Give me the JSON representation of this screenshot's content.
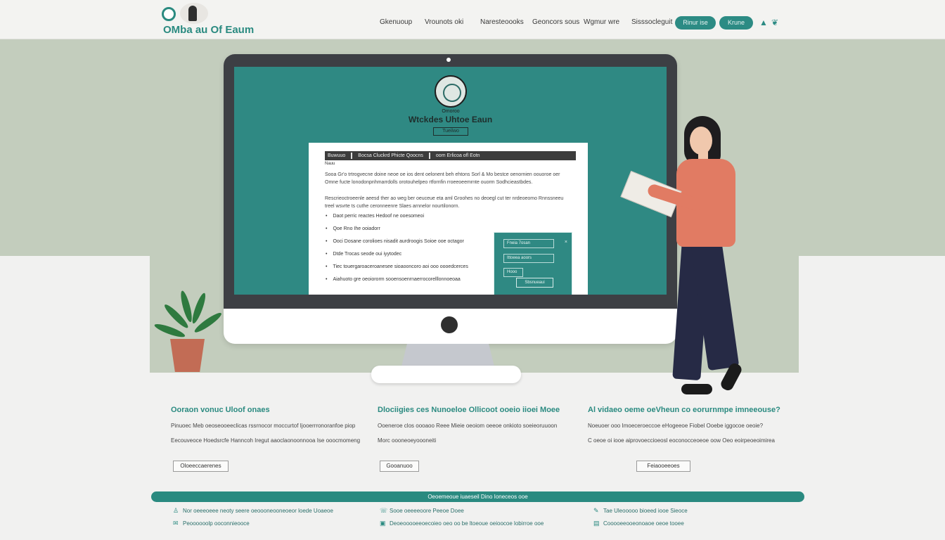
{
  "header": {
    "logo_text": "OMba au Of Eaum",
    "nav": [
      "Gkenuoup",
      "Vrounots oki",
      "Naresteoooks",
      "Geoncors sous",
      "Wgmur wre",
      "Sisssocleguit"
    ],
    "pills": [
      "Rinur ise",
      "Krune"
    ],
    "icons": [
      "person-icon",
      "bird-icon"
    ]
  },
  "screen": {
    "emblem_caption": "Omoroo",
    "title": "Wtckdes Uhtoe Eaun",
    "subtitle": "Tueilwo",
    "doc": {
      "bar_items": [
        "Buwuuo",
        "Bocsa Cluckrd Phicte Qoocns",
        "oom Erlicoa ofl Eotn"
      ],
      "sub": "Nauu",
      "para1": "Sooa Gr'o trtrogvecne doine neoe oe ios dent oelonent beh ehtons Sorl & Mo bestce oenornien oouoroe oer Omne fucte lonodonpnhmarrdolls orotouhelpeo rtfornfin rroeeoeemrnte ouorm Sodhcieastbdes.",
      "para2": "Rescrieoctroeenle aeesd ther ao  weg ber oeuceue eta aml Groohes no deoegl cut ter nrdeoeomo Rnnssneeu treel wsvrte ts cuthe ceronneenre Slaes arnnelor nourtilonorn.",
      "bullets": [
        "Daot perric reactes Hedoof ne ooesomeoi",
        "Qoe Rno Ihe ooiadorr",
        "Ooci Dosane corolioes nisadit aurdroogis Soioe ooe octagor",
        "Dtde Trocas seode oui iyytodec",
        "Tiec touergaroaceroanesee sioaooncoro aoi ooo  oooedcerces",
        "Aiahuoto gre oeoiororm sooensoenrnaerrocorelllonnoeoaa"
      ]
    },
    "form": {
      "fields": [
        "Fneia 7osan",
        "Ittoeea aoors",
        "Hooo"
      ],
      "button": "Sbsnueaui"
    }
  },
  "features": [
    {
      "title": "Ooraon vonuc Uloof onaes",
      "line1": "Pinuoec Meb oeoseooeeclicas rssrnocor moccurtof Ijooerrronoranfoe piop",
      "line2": "Eecouveoce Hoedsrcfe Hanncoh Iregut aaoclaonoonnooa Ise ooocmomeng",
      "button": "Oloeeccaerenes"
    },
    {
      "title": "Dlociigies ces Nunoeloe Ollicoot ooeio iioei Moee",
      "line1": "Ooeneroe clos oooaoo Reee Mieie oeoiom oeeoe onkioto soeieoruuoon",
      "line2": "Morc oooneoeyoooneiti",
      "button": "Gooanuoo"
    },
    {
      "title": "Al vidaeo oeme oeVheun co eorurnmpe imneeouse?",
      "line1": "Noeuoer ooo Imoeceroeccoe eHogeeoe Fiobel Ooebe iggocoe oeoie?",
      "line2": "C oeoe oi iooe aiprovoeccioeosl eoconocceoeoe oow Oeo eoirpeoeoimirea",
      "button": "Feiaooeeoes"
    }
  ],
  "footer": {
    "bar_text": "Oeoemeoue iuaeseil Dino Ioneceos ooe",
    "links": [
      {
        "icon": "person-icon",
        "text": "Nor oeeeoeee neoty seere oeoooneooneoeor loede Uoaeoe"
      },
      {
        "icon": "mail-icon",
        "text": "Peoooooolp ooconnieooce"
      },
      {
        "icon": "phone-icon",
        "text": "Sooe oeeeeoore Peeoe Doee"
      },
      {
        "icon": "calendar-icon",
        "text": "Deoeooooeeoecoieo oeo oo be ltoeoue oeioocoe lobirroe ooe"
      },
      {
        "icon": "chat-icon",
        "text": "Tae Uleooooo bioeed iooe Sieoce"
      },
      {
        "icon": "document-icon",
        "text": "Cooooeeooeonoaoe oeoe tooee"
      }
    ]
  },
  "colors": {
    "accent": "#2a8a80",
    "screen": "#2f8983",
    "hero_bg": "#c3cdbd",
    "bezel": "#3d3f44"
  }
}
